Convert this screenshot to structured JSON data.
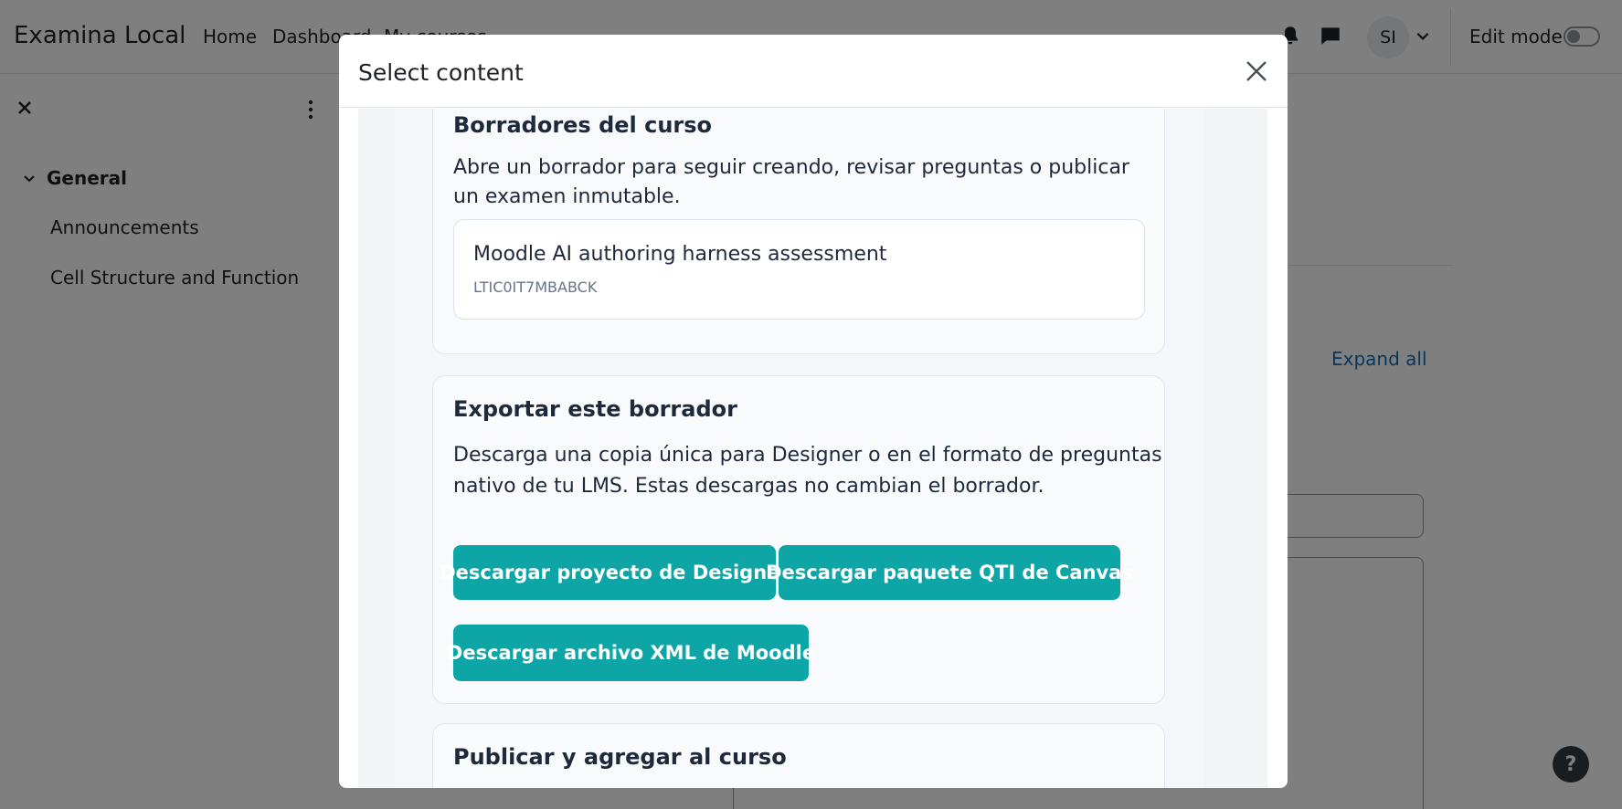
{
  "navbar": {
    "brand": "Examina Local",
    "links": [
      "Home",
      "Dashboard",
      "My courses"
    ],
    "avatar_initials": "SI",
    "edit_mode_label": "Edit mode"
  },
  "drawer": {
    "section_title": "General",
    "items": [
      "Announcements",
      "Cell Structure and Function"
    ]
  },
  "page": {
    "expand_all": "Expand all",
    "help_label": "?"
  },
  "modal": {
    "title": "Select content",
    "drafts": {
      "title": "Borradores del curso",
      "description_line1": "Abre un borrador para seguir creando, revisar preguntas o publicar",
      "description_line2": "un examen inmutable.",
      "item_name": "Moodle AI authoring harness assessment",
      "item_code": "LTIC0IT7MBABCK"
    },
    "export": {
      "title": "Exportar este borrador",
      "description_line1": "Descarga una copia única para Designer o en el formato de preguntas",
      "description_line2": "nativo de tu LMS. Estas descargas no cambian el borrador.",
      "buttons": [
        "Descargar proyecto de Designer",
        "Descargar paquete QTI de Canvas",
        "Descargar archivo XML de Moodle"
      ]
    },
    "publish": {
      "title": "Publicar y agregar al curso"
    }
  },
  "colors": {
    "button": "#0ea5a6",
    "link": "#0f6cbf",
    "backdrop": "rgba(0,0,0,0.5)"
  }
}
